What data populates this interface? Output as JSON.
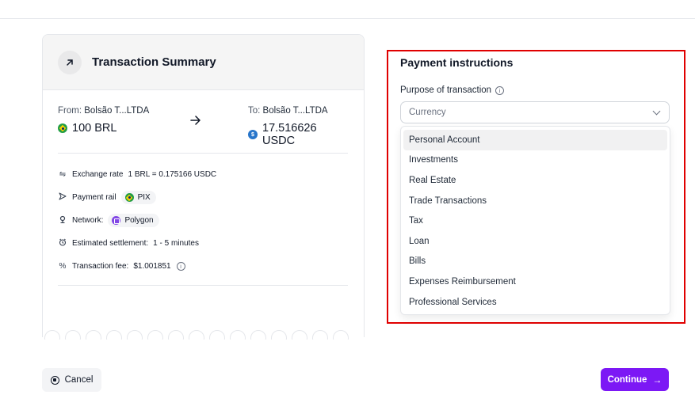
{
  "summary": {
    "title": "Transaction Summary",
    "from_prefix": "From: ",
    "from_name": "Bolsão T...LTDA",
    "from_amount": "100 BRL",
    "to_prefix": "To: ",
    "to_name": "Bolsão T...LTDA",
    "to_amount": "17.516626 USDC",
    "details": {
      "exchange_label": "Exchange rate",
      "exchange_value": "1 BRL = 0.175166 USDC",
      "rail_label": "Payment rail",
      "rail_value": "PIX",
      "network_label": "Network:",
      "network_value": "Polygon",
      "settlement_label": "Estimated settlement:",
      "settlement_value": "1 - 5 minutes",
      "fee_label": "Transaction fee:",
      "fee_value": "$1.001851"
    }
  },
  "payment": {
    "title": "Payment instructions",
    "purpose_label": "Purpose of transaction",
    "select_placeholder": "Currency",
    "options": [
      "Personal Account",
      "Investments",
      "Real Estate",
      "Trade Transactions",
      "Tax",
      "Loan",
      "Bills",
      "Expenses Reimbursement",
      "Professional Services"
    ]
  },
  "buttons": {
    "cancel": "Cancel",
    "continue": "Continue"
  },
  "colors": {
    "accent": "#7c18f5",
    "highlight_border": "#e00000"
  },
  "icons": [
    "arrow-up-right-icon",
    "arrow-right-icon",
    "exchange-icon",
    "send-icon",
    "network-icon",
    "clock-icon",
    "percent-icon",
    "info-icon",
    "chevron-down-icon",
    "stop-circle-icon"
  ]
}
